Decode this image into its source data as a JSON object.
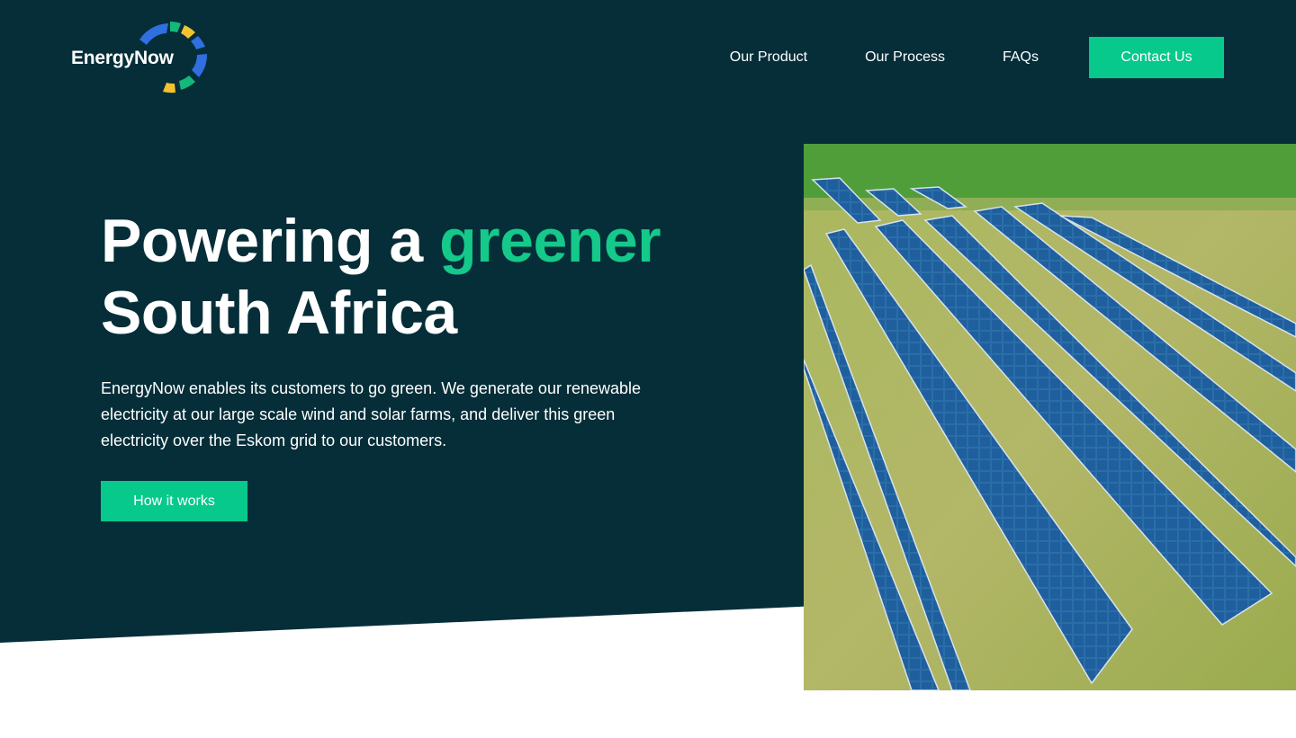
{
  "brand": {
    "name": "EnergyNow",
    "colors": {
      "background_dark": "#052e38",
      "accent_green": "#06c98b",
      "logo_blue": "#2f6fe0",
      "logo_yellow": "#f2c230",
      "logo_green": "#13b87a"
    }
  },
  "nav": {
    "links": [
      "Our Product",
      "Our Process",
      "FAQs"
    ],
    "cta_label": "Contact Us"
  },
  "hero": {
    "title_part1": "Powering a ",
    "title_accent": "greener",
    "title_line2": "South Africa",
    "description": "EnergyNow enables its customers to go green. We generate our renewable electricity at our large scale wind and solar farms, and deliver this green electricity over the Eskom grid to our customers.",
    "button_label": "How it works",
    "image_subject": "aerial view of solar panel rows on a grass field"
  }
}
